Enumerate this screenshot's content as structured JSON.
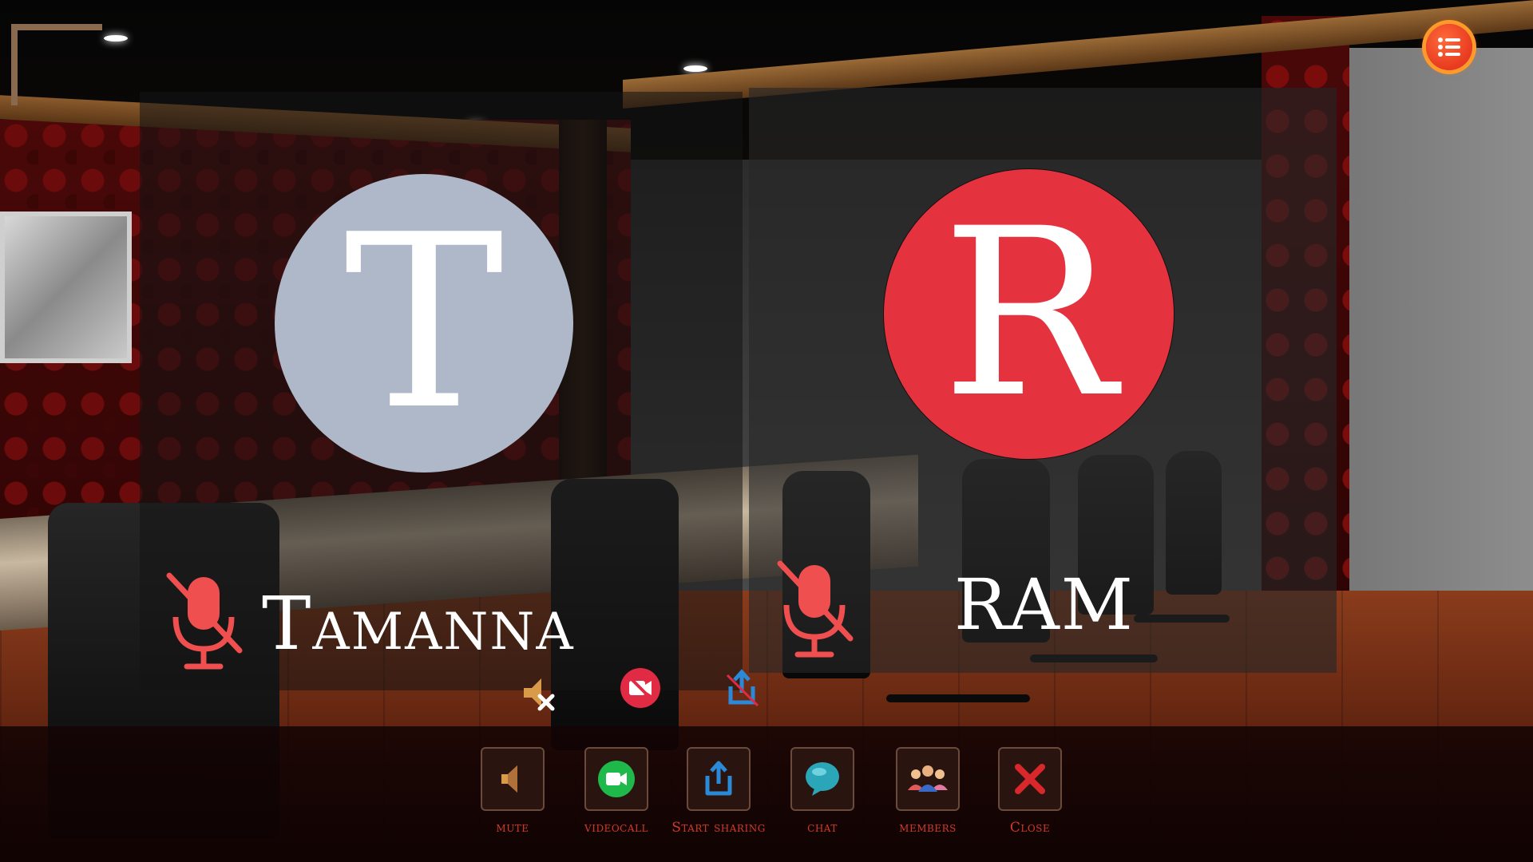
{
  "participants": [
    {
      "initial": "T",
      "name": "Tamanna",
      "avatar_color": "#aeb8c8",
      "mic_state": "muted"
    },
    {
      "initial": "R",
      "name": "RAM",
      "avatar_color": "#e5323f",
      "mic_state": "muted"
    }
  ],
  "toolbar": {
    "mute_label": "mute",
    "videocall_label": "videocall",
    "share_label": "Start sharing",
    "chat_label": "chat",
    "members_label": "members",
    "close_label": "Close"
  },
  "icons": {
    "menu": "list-icon",
    "mute": "speaker-icon",
    "videocall": "video-camera-icon",
    "share": "share-upload-icon",
    "chat": "speech-bubble-icon",
    "members": "group-icon",
    "close": "x-icon",
    "participant_mic": "microphone-off-icon"
  },
  "colors": {
    "accent_red": "#d23a2a",
    "menu_orange": "#e83a20",
    "video_green": "#1fb84a",
    "chat_teal": "#2aa6b8",
    "share_blue": "#2a8ad8"
  }
}
